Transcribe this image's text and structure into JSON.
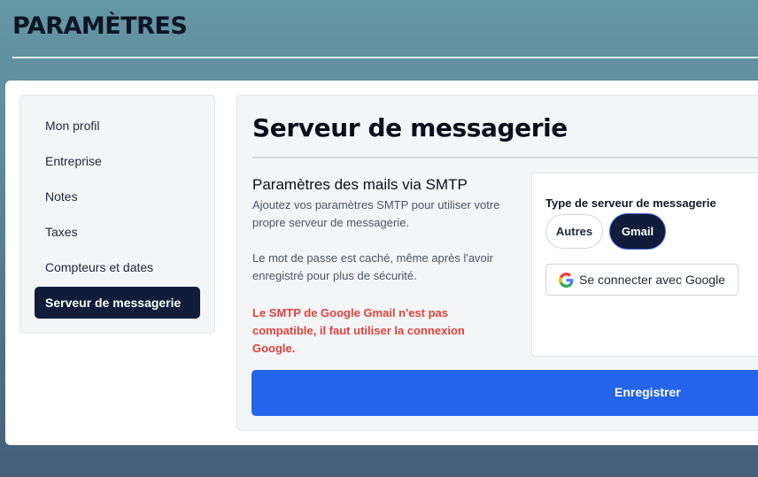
{
  "page": {
    "title": "PARAMÈTRES"
  },
  "sidebar": {
    "items": [
      {
        "label": "Mon profil"
      },
      {
        "label": "Entreprise"
      },
      {
        "label": "Notes"
      },
      {
        "label": "Taxes"
      },
      {
        "label": "Compteurs et dates"
      },
      {
        "label": "Serveur de messagerie",
        "active": true
      }
    ]
  },
  "main": {
    "title": "Serveur de messagerie",
    "section_title": "Paramètres des mails via SMTP",
    "desc1": "Ajoutez vos paramètres SMTP pour utiliser votre propre serveur de messagerie.",
    "desc2": "Le mot de passe est caché, même après l'avoir enregistré pour plus de sécurité.",
    "warning": "Le SMTP de Google Gmail n'est pas compatible, il faut utiliser la connexion Google.",
    "server_type": {
      "label": "Type de serveur de messagerie",
      "options": [
        "Autres",
        "Gmail"
      ],
      "selected": "Gmail"
    },
    "google_button": "Se connecter avec Google",
    "save_button": "Enregistrer"
  },
  "colors": {
    "accent": "#2563eb",
    "active_dark": "#111c3a",
    "warning": "#e0413c"
  },
  "icons": [
    "google-icon"
  ]
}
